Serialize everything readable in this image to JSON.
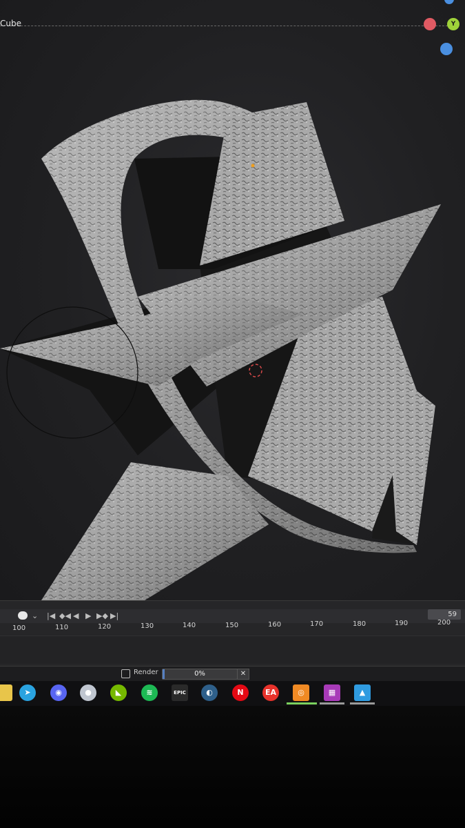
{
  "viewport": {
    "object_name": "Cube",
    "gizmo": {
      "y_label": "Y"
    }
  },
  "timeline": {
    "current_frame": "59",
    "ticks": [
      "100",
      "110",
      "120",
      "130",
      "140",
      "150",
      "160",
      "170",
      "180",
      "190",
      "200"
    ],
    "controls": {
      "jump_start": "|◀",
      "prev_key": "◆◀",
      "play_reverse": "◀",
      "play": "▶",
      "next_key": "▶◆",
      "jump_end": "▶|"
    }
  },
  "status_bar": {
    "render_label": "Render",
    "render_progress_value": 0.03,
    "render_progress_text": "0%",
    "cancel_label": "✕"
  },
  "taskbar": {
    "icons": [
      {
        "name": "folder-icon",
        "glyph": "",
        "color": "#e8c54a"
      },
      {
        "name": "telegram-icon",
        "glyph": "➤",
        "color": "#2aa3e0"
      },
      {
        "name": "discord-icon",
        "glyph": "◉",
        "color": "#5865f2"
      },
      {
        "name": "app-icon",
        "glyph": "●",
        "color": "#c0c6d0"
      },
      {
        "name": "nvidia-icon",
        "glyph": "◣",
        "color": "#76b900"
      },
      {
        "name": "spotify-icon",
        "glyph": "≋",
        "color": "#1db954"
      },
      {
        "name": "epic-games-icon",
        "glyph": "EPIC",
        "color": "#2a2a2a"
      },
      {
        "name": "steam-icon",
        "glyph": "◐",
        "color": "#2e5f8a"
      },
      {
        "name": "netflix-icon",
        "glyph": "N",
        "color": "#e50914"
      },
      {
        "name": "ea-icon",
        "glyph": "EA",
        "color": "#e8322b"
      },
      {
        "name": "blender-icon",
        "glyph": "◎",
        "color": "#f08a24"
      },
      {
        "name": "winrar-icon",
        "glyph": "▦",
        "color": "#a83ab8"
      },
      {
        "name": "photos-icon",
        "glyph": "▲",
        "color": "#2f9be0"
      }
    ]
  }
}
